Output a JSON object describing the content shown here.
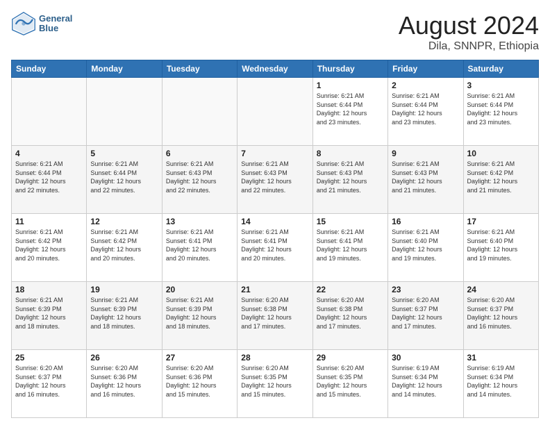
{
  "header": {
    "logo_line1": "General",
    "logo_line2": "Blue",
    "title": "August 2024",
    "subtitle": "Dila, SNNPR, Ethiopia"
  },
  "days_of_week": [
    "Sunday",
    "Monday",
    "Tuesday",
    "Wednesday",
    "Thursday",
    "Friday",
    "Saturday"
  ],
  "weeks": [
    [
      {
        "num": "",
        "info": ""
      },
      {
        "num": "",
        "info": ""
      },
      {
        "num": "",
        "info": ""
      },
      {
        "num": "",
        "info": ""
      },
      {
        "num": "1",
        "info": "Sunrise: 6:21 AM\nSunset: 6:44 PM\nDaylight: 12 hours\nand 23 minutes."
      },
      {
        "num": "2",
        "info": "Sunrise: 6:21 AM\nSunset: 6:44 PM\nDaylight: 12 hours\nand 23 minutes."
      },
      {
        "num": "3",
        "info": "Sunrise: 6:21 AM\nSunset: 6:44 PM\nDaylight: 12 hours\nand 23 minutes."
      }
    ],
    [
      {
        "num": "4",
        "info": "Sunrise: 6:21 AM\nSunset: 6:44 PM\nDaylight: 12 hours\nand 22 minutes."
      },
      {
        "num": "5",
        "info": "Sunrise: 6:21 AM\nSunset: 6:44 PM\nDaylight: 12 hours\nand 22 minutes."
      },
      {
        "num": "6",
        "info": "Sunrise: 6:21 AM\nSunset: 6:43 PM\nDaylight: 12 hours\nand 22 minutes."
      },
      {
        "num": "7",
        "info": "Sunrise: 6:21 AM\nSunset: 6:43 PM\nDaylight: 12 hours\nand 22 minutes."
      },
      {
        "num": "8",
        "info": "Sunrise: 6:21 AM\nSunset: 6:43 PM\nDaylight: 12 hours\nand 21 minutes."
      },
      {
        "num": "9",
        "info": "Sunrise: 6:21 AM\nSunset: 6:43 PM\nDaylight: 12 hours\nand 21 minutes."
      },
      {
        "num": "10",
        "info": "Sunrise: 6:21 AM\nSunset: 6:42 PM\nDaylight: 12 hours\nand 21 minutes."
      }
    ],
    [
      {
        "num": "11",
        "info": "Sunrise: 6:21 AM\nSunset: 6:42 PM\nDaylight: 12 hours\nand 20 minutes."
      },
      {
        "num": "12",
        "info": "Sunrise: 6:21 AM\nSunset: 6:42 PM\nDaylight: 12 hours\nand 20 minutes."
      },
      {
        "num": "13",
        "info": "Sunrise: 6:21 AM\nSunset: 6:41 PM\nDaylight: 12 hours\nand 20 minutes."
      },
      {
        "num": "14",
        "info": "Sunrise: 6:21 AM\nSunset: 6:41 PM\nDaylight: 12 hours\nand 20 minutes."
      },
      {
        "num": "15",
        "info": "Sunrise: 6:21 AM\nSunset: 6:41 PM\nDaylight: 12 hours\nand 19 minutes."
      },
      {
        "num": "16",
        "info": "Sunrise: 6:21 AM\nSunset: 6:40 PM\nDaylight: 12 hours\nand 19 minutes."
      },
      {
        "num": "17",
        "info": "Sunrise: 6:21 AM\nSunset: 6:40 PM\nDaylight: 12 hours\nand 19 minutes."
      }
    ],
    [
      {
        "num": "18",
        "info": "Sunrise: 6:21 AM\nSunset: 6:39 PM\nDaylight: 12 hours\nand 18 minutes."
      },
      {
        "num": "19",
        "info": "Sunrise: 6:21 AM\nSunset: 6:39 PM\nDaylight: 12 hours\nand 18 minutes."
      },
      {
        "num": "20",
        "info": "Sunrise: 6:21 AM\nSunset: 6:39 PM\nDaylight: 12 hours\nand 18 minutes."
      },
      {
        "num": "21",
        "info": "Sunrise: 6:20 AM\nSunset: 6:38 PM\nDaylight: 12 hours\nand 17 minutes."
      },
      {
        "num": "22",
        "info": "Sunrise: 6:20 AM\nSunset: 6:38 PM\nDaylight: 12 hours\nand 17 minutes."
      },
      {
        "num": "23",
        "info": "Sunrise: 6:20 AM\nSunset: 6:37 PM\nDaylight: 12 hours\nand 17 minutes."
      },
      {
        "num": "24",
        "info": "Sunrise: 6:20 AM\nSunset: 6:37 PM\nDaylight: 12 hours\nand 16 minutes."
      }
    ],
    [
      {
        "num": "25",
        "info": "Sunrise: 6:20 AM\nSunset: 6:37 PM\nDaylight: 12 hours\nand 16 minutes."
      },
      {
        "num": "26",
        "info": "Sunrise: 6:20 AM\nSunset: 6:36 PM\nDaylight: 12 hours\nand 16 minutes."
      },
      {
        "num": "27",
        "info": "Sunrise: 6:20 AM\nSunset: 6:36 PM\nDaylight: 12 hours\nand 15 minutes."
      },
      {
        "num": "28",
        "info": "Sunrise: 6:20 AM\nSunset: 6:35 PM\nDaylight: 12 hours\nand 15 minutes."
      },
      {
        "num": "29",
        "info": "Sunrise: 6:20 AM\nSunset: 6:35 PM\nDaylight: 12 hours\nand 15 minutes."
      },
      {
        "num": "30",
        "info": "Sunrise: 6:19 AM\nSunset: 6:34 PM\nDaylight: 12 hours\nand 14 minutes."
      },
      {
        "num": "31",
        "info": "Sunrise: 6:19 AM\nSunset: 6:34 PM\nDaylight: 12 hours\nand 14 minutes."
      }
    ]
  ]
}
